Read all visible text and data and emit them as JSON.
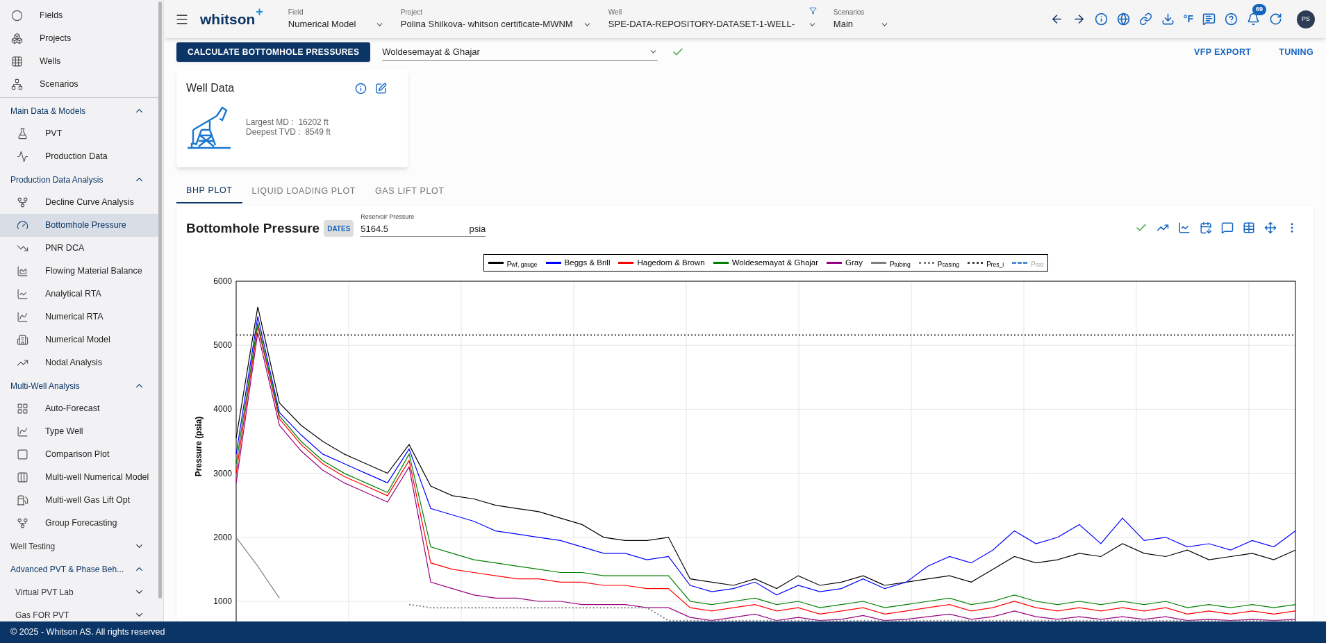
{
  "sidebar": {
    "top_items": [
      {
        "label": "Fields",
        "selected": false
      },
      {
        "label": "Projects",
        "selected": false
      },
      {
        "label": "Wells",
        "selected": false
      },
      {
        "label": "Scenarios",
        "selected": false
      }
    ],
    "sections": [
      {
        "title": "Main Data & Models",
        "expanded": true,
        "items": [
          {
            "label": "PVT",
            "selected": false
          },
          {
            "label": "Production Data",
            "selected": false
          }
        ]
      },
      {
        "title": "Production Data Analysis",
        "expanded": true,
        "items": [
          {
            "label": "Decline Curve Analysis",
            "selected": false
          },
          {
            "label": "Bottomhole Pressure",
            "selected": true
          },
          {
            "label": "PNR DCA",
            "selected": false
          },
          {
            "label": "Flowing Material Balance",
            "selected": false
          },
          {
            "label": "Analytical RTA",
            "selected": false
          },
          {
            "label": "Numerical RTA",
            "selected": false
          },
          {
            "label": "Numerical Model",
            "selected": false
          },
          {
            "label": "Nodal Analysis",
            "selected": false
          }
        ]
      },
      {
        "title": "Multi-Well Analysis",
        "expanded": true,
        "items": [
          {
            "label": "Auto-Forecast",
            "selected": false
          },
          {
            "label": "Type Well",
            "selected": false
          },
          {
            "label": "Comparison Plot",
            "selected": false
          },
          {
            "label": "Multi-well Numerical Model",
            "selected": false
          },
          {
            "label": "Multi-well Gas Lift Opt",
            "selected": false
          },
          {
            "label": "Group Forecasting",
            "selected": false
          }
        ]
      },
      {
        "title": "Well Testing",
        "expanded": false
      },
      {
        "title": "Advanced PVT & Phase Beh...",
        "expanded": true,
        "subsections": [
          {
            "title": "Virtual PVT Lab",
            "expanded": false
          },
          {
            "title": "Gas FOR PVT",
            "expanded": false
          }
        ]
      }
    ]
  },
  "header": {
    "logo": "whitson",
    "logo_mark": "+",
    "selectors": [
      {
        "label": "Field",
        "value": "Numerical Model"
      },
      {
        "label": "Project",
        "value": "Polina Shilkova- whitson certificate-MWNM"
      },
      {
        "label": "Well",
        "value": "SPE-DATA-REPOSITORY-DATASET-1-WELL-"
      },
      {
        "label": "Scenarios",
        "value": "Main"
      }
    ],
    "unit_toggle": "°F",
    "notifications": "69",
    "avatar": "PS"
  },
  "toolbar": {
    "calculate_button": "CALCULATE BOTTOMHOLE PRESSURES",
    "correlation": "Woldesemayat & Ghajar",
    "actions": [
      "VFP EXPORT",
      "TUNING"
    ]
  },
  "well_data": {
    "title": "Well Data",
    "rows": [
      {
        "label": "Largest MD :",
        "value": "16202 ft"
      },
      {
        "label": "Deepest TVD :",
        "value": "8549 ft"
      }
    ]
  },
  "tabs": [
    {
      "label": "BHP PLOT",
      "selected": true
    },
    {
      "label": "LIQUID LOADING PLOT",
      "selected": false
    },
    {
      "label": "GAS LIFT PLOT",
      "selected": false
    }
  ],
  "plot": {
    "title": "Bottomhole Pressure",
    "dates_button": "DATES",
    "reservoir_pressure": {
      "label": "Reservoir Pressure",
      "value": "5164.5",
      "unit": "psia"
    },
    "chart_data": {
      "type": "line",
      "ylabel": "Pressure (psia)",
      "ylim": [
        650,
        6000
      ],
      "yticks": [
        6000,
        5000,
        4000,
        3000,
        2000,
        1000
      ],
      "grid": true,
      "legend": "top",
      "series": [
        {
          "name": "p$_{wf, gauge}$",
          "line_style": "solid",
          "color": "#000000",
          "values": [
            3550,
            5600,
            4100,
            3750,
            3500,
            3300,
            3150,
            3000,
            3450,
            2800,
            2650,
            2600,
            2500,
            2450,
            2400,
            2300,
            2200,
            2000,
            1950,
            1950,
            2000,
            1350,
            1300,
            1250,
            1350,
            1200,
            1400,
            1250,
            1300,
            1400,
            1250,
            1300,
            1350,
            1400,
            1300,
            1500,
            1700,
            1600,
            1650,
            1750,
            1700,
            1900,
            1750,
            1700,
            1800,
            1650,
            1700,
            1750,
            1650,
            1800
          ]
        },
        {
          "name": "Beggs & Brill",
          "line_style": "solid",
          "color": "#0000ff",
          "values": [
            3300,
            5450,
            3950,
            3600,
            3300,
            3150,
            3000,
            2850,
            3380,
            2450,
            2350,
            2250,
            2100,
            2050,
            2000,
            1950,
            1850,
            1750,
            1750,
            1650,
            1700,
            1250,
            1150,
            1200,
            1300,
            1100,
            1250,
            1150,
            1200,
            1350,
            1200,
            1300,
            1550,
            1700,
            1600,
            1800,
            2100,
            1900,
            2000,
            2200,
            1900,
            2300,
            1950,
            2000,
            1850,
            1900,
            1800,
            1950,
            1850,
            2100
          ]
        },
        {
          "name": "Hagedorn & Brown",
          "line_style": "solid",
          "color": "#ff0000",
          "values": [
            3000,
            5300,
            3850,
            3450,
            3150,
            2950,
            2800,
            2650,
            3200,
            1600,
            1500,
            1450,
            1400,
            1350,
            1350,
            1300,
            1300,
            1250,
            1250,
            1200,
            1200,
            900,
            850,
            900,
            950,
            850,
            900,
            800,
            850,
            900,
            800,
            850,
            900,
            950,
            850,
            900,
            1000,
            900,
            850,
            900,
            850,
            900,
            850,
            900,
            800,
            850,
            800,
            850,
            800,
            850
          ]
        },
        {
          "name": "Woldesemayat & Ghajar",
          "line_style": "solid",
          "color": "#008000",
          "values": [
            3150,
            5350,
            3900,
            3500,
            3200,
            3000,
            2850,
            2700,
            3300,
            1850,
            1750,
            1650,
            1600,
            1550,
            1500,
            1450,
            1450,
            1400,
            1400,
            1400,
            1400,
            1000,
            950,
            1000,
            1050,
            950,
            1000,
            900,
            950,
            1000,
            900,
            950,
            1000,
            1050,
            950,
            1000,
            1100,
            1000,
            950,
            1000,
            950,
            1000,
            950,
            1000,
            900,
            950,
            900,
            950,
            900,
            950
          ]
        },
        {
          "name": "Gray",
          "line_style": "solid",
          "color": "#990080",
          "values": [
            2850,
            5200,
            3750,
            3350,
            3050,
            2850,
            2700,
            2550,
            3100,
            1300,
            1200,
            1100,
            1050,
            1050,
            1000,
            1000,
            950,
            950,
            950,
            900,
            900,
            750,
            700,
            750,
            800,
            700,
            750,
            700,
            720,
            780,
            700,
            720,
            760,
            800,
            720,
            760,
            850,
            760,
            720,
            760,
            720,
            760,
            720,
            760,
            700,
            720,
            700,
            720,
            700,
            720
          ]
        },
        {
          "name": "p$_{tubing}$",
          "line_style": "solid",
          "color": "#808080",
          "values": [
            2000,
            1550,
            1050,
            null,
            null,
            null,
            null,
            null,
            null,
            null,
            null,
            null,
            null,
            null,
            null,
            null,
            null,
            null,
            null,
            null,
            null,
            null,
            null,
            null,
            null,
            null,
            null,
            null,
            null,
            null,
            null,
            null,
            null,
            null,
            null,
            null,
            null,
            null,
            null,
            null,
            null,
            null,
            null,
            null,
            null,
            null,
            null,
            null,
            null,
            null
          ]
        },
        {
          "name": "p$_{casing}$",
          "line_style": "dotted",
          "color": "#808080",
          "values": [
            null,
            null,
            null,
            null,
            null,
            null,
            null,
            null,
            950,
            900,
            900,
            900,
            900,
            900,
            900,
            900,
            900,
            900,
            900,
            900,
            700,
            700,
            700,
            700,
            700,
            700,
            700,
            700,
            700,
            700,
            700,
            700,
            700,
            700,
            700,
            700,
            700,
            700,
            700,
            700,
            700,
            700,
            700,
            700,
            700,
            700,
            700,
            700,
            700,
            700
          ]
        },
        {
          "name": "p$_{res_i}$",
          "line_style": "dotted",
          "color": "#404040",
          "values": [
            5160,
            5160,
            5160,
            5160,
            5160,
            5160,
            5160,
            5160,
            5160,
            5160,
            5160,
            5160,
            5160,
            5160,
            5160,
            5160,
            5160,
            5160,
            5160,
            5160,
            5160,
            5160,
            5160,
            5160,
            5160,
            5160,
            5160,
            5160,
            5160,
            5160,
            5160,
            5160,
            5160,
            5160,
            5160,
            5160,
            5160,
            5160,
            5160,
            5160,
            5160,
            5160,
            5160,
            5160,
            5160,
            5160,
            5160,
            5160,
            5160,
            5160
          ]
        },
        {
          "name": "p$_{sat}$",
          "line_style": "dashed",
          "color": "#4a90d9"
        }
      ]
    }
  },
  "footer": "© 2025 - Whitson AS. All rights reserved"
}
